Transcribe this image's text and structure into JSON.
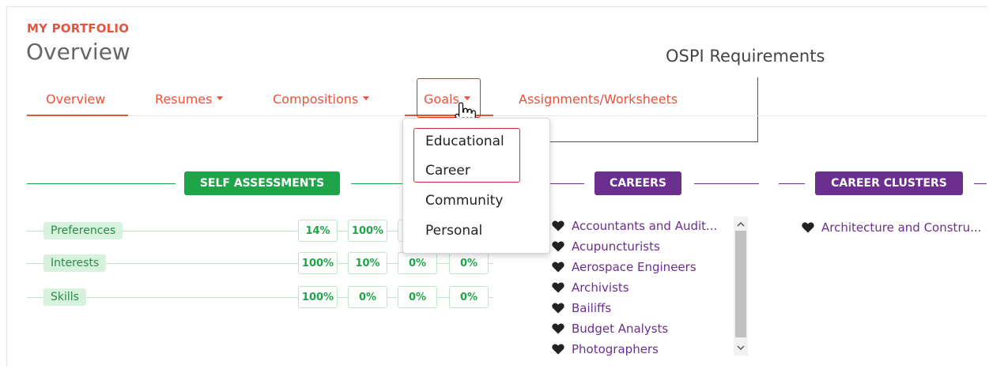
{
  "header": {
    "eyebrow": "MY PORTFOLIO",
    "title": "Overview"
  },
  "annotation": {
    "label": "OSPI Requirements"
  },
  "tabs": [
    {
      "label": "Overview",
      "has_caret": false,
      "active": true
    },
    {
      "label": "Resumes",
      "has_caret": true,
      "active": false
    },
    {
      "label": "Compositions",
      "has_caret": true,
      "active": false
    },
    {
      "label": "Goals",
      "has_caret": true,
      "active": false,
      "highlighted": true
    },
    {
      "label": "Assignments/Worksheets",
      "has_caret": false,
      "active": false
    }
  ],
  "goals_menu": {
    "items": [
      "Educational",
      "Career",
      "Community",
      "Personal"
    ],
    "highlighted_items": [
      "Educational",
      "Career"
    ]
  },
  "self_assessments": {
    "title": "SELF ASSESSMENTS",
    "rows": [
      {
        "label": "Preferences",
        "values": [
          "14%",
          "100%",
          "",
          ""
        ]
      },
      {
        "label": "Interests",
        "values": [
          "100%",
          "10%",
          "0%",
          "0%"
        ]
      },
      {
        "label": "Skills",
        "values": [
          "100%",
          "0%",
          "0%",
          "0%"
        ]
      }
    ]
  },
  "careers": {
    "title": "CAREERS",
    "items": [
      "Accountants and Audit...",
      "Acupuncturists",
      "Aerospace Engineers",
      "Archivists",
      "Bailiffs",
      "Budget Analysts",
      "Photographers"
    ]
  },
  "career_clusters": {
    "title": "CAREER CLUSTERS",
    "items": [
      "Architecture and Constru..."
    ]
  },
  "colors": {
    "accent": "#e8533c",
    "green": "#1ea54a",
    "purple": "#6b2f8f",
    "highlight": "#d9312a"
  }
}
